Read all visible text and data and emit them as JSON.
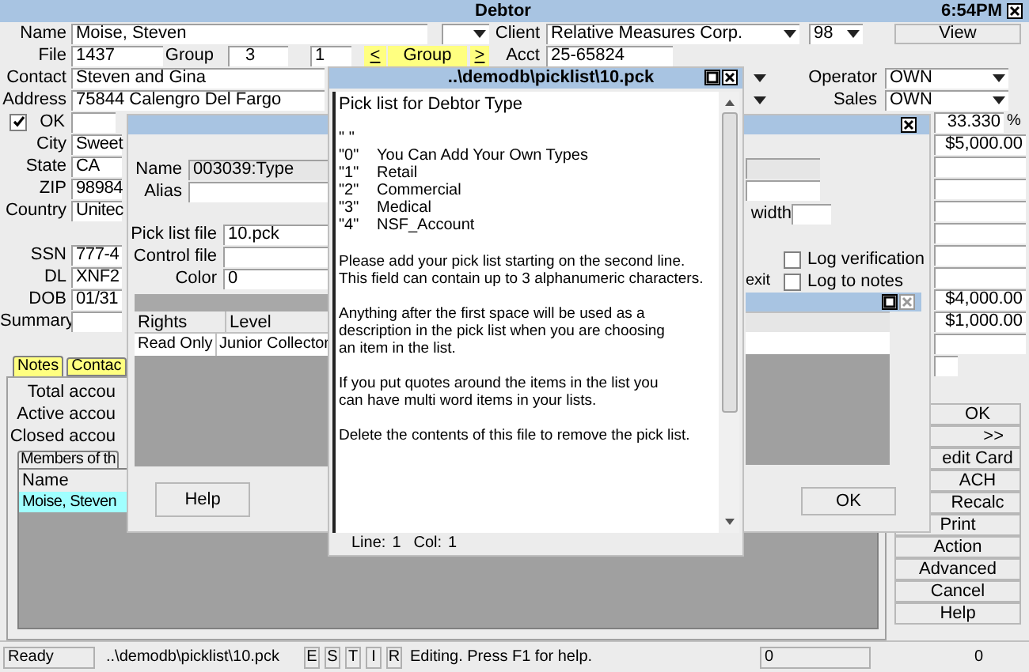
{
  "main": {
    "title": "Debtor",
    "clock": "6:54PM",
    "name": {
      "label": "Name",
      "value": "Moise, Steven"
    },
    "client": {
      "label": "Client",
      "value": "Relative Measures Corp.",
      "number": "98"
    },
    "view_button": "View",
    "file": {
      "label": "File",
      "value": "1437"
    },
    "group": {
      "label": "Group",
      "value": "3",
      "page": "1",
      "prev": "<",
      "button": "Group",
      "next": ">"
    },
    "acct": {
      "label": "Acct",
      "value": "25-65824"
    },
    "contact": {
      "label": "Contact",
      "value": "Steven and Gina"
    },
    "address": {
      "label": "Address",
      "value": "75844 Calengro Del Fargo"
    },
    "operator": {
      "label": "Operator",
      "value": "OWN"
    },
    "sales": {
      "label": "Sales",
      "value": "OWN"
    },
    "ok_checkbox": {
      "label": "OK",
      "checked": true
    },
    "fields": [
      {
        "label": "City",
        "value": "Sweet"
      },
      {
        "label": "State",
        "value": "CA"
      },
      {
        "label": "ZIP",
        "value": "98984"
      },
      {
        "label": "Country",
        "value": "Unitec"
      },
      {
        "label": "SSN",
        "value": "777-4"
      },
      {
        "label": "DL",
        "value": "XNF2"
      },
      {
        "label": "DOB",
        "value": "01/31"
      },
      {
        "label": "Summary"
      }
    ],
    "percent": {
      "value": "33.330",
      "unit": "%"
    },
    "amounts_top": [
      "$5,000.00"
    ],
    "amounts_bottom": [
      "$4,000.00",
      "$1,000.00"
    ],
    "tabs": [
      {
        "label": "Notes",
        "selected": true
      },
      {
        "label": "Contac",
        "selected": false
      }
    ],
    "counts": [
      "Total accou",
      "Active accou",
      "Closed accou"
    ],
    "members": {
      "tab": "Members of th",
      "column": "Name",
      "rows": [
        {
          "name": "Moise, Steven",
          "selected": true
        }
      ]
    },
    "side_buttons": [
      "OK",
      ">>",
      "edit Card",
      "ACH",
      "Recalc",
      "Print",
      "Action",
      "Advanced",
      "Cancel",
      "Help"
    ]
  },
  "dialog": {
    "name": {
      "label": "Name",
      "value": "003039:Type"
    },
    "alias": {
      "label": "Alias"
    },
    "pick_list_file": {
      "label": "Pick list file",
      "value": "10.pck"
    },
    "control_file": {
      "label": "Control file"
    },
    "color": {
      "label": "Color",
      "value": "0"
    },
    "table": {
      "columns": [
        "Rights",
        "Level"
      ],
      "rows": [
        [
          "Read Only",
          "Junior Collector"
        ]
      ]
    },
    "help_button": "Help",
    "width_label": "width",
    "exit_label": "exit",
    "checkboxes": [
      {
        "label": "Log verification",
        "checked": false
      },
      {
        "label": "Log to notes",
        "checked": false
      }
    ],
    "ok_button": "OK"
  },
  "editor": {
    "title": "..\\demodb\\picklist\\10.pck",
    "paragraphs": [
      {
        "kind": "text",
        "lines": [
          "Pick list for Debtor Type"
        ]
      },
      {
        "kind": "items",
        "items": [
          {
            "code": "\" \""
          },
          {
            "code": "\"0\"",
            "text": "You Can Add Your Own Types"
          },
          {
            "code": "\"1\"",
            "text": "Retail"
          },
          {
            "code": "\"2\"",
            "text": "Commercial"
          },
          {
            "code": "\"3\"",
            "text": "Medical"
          },
          {
            "code": "\"4\"",
            "text": "NSF_Account"
          }
        ]
      },
      {
        "kind": "text",
        "lines": [
          "Please add your pick list starting on the second line.",
          "This field can contain up to 3 alphanumeric characters."
        ]
      },
      {
        "kind": "text",
        "lines": [
          "Anything after the first space will be used as a",
          "description in the pick list when you are choosing",
          "an item in the list."
        ]
      },
      {
        "kind": "text",
        "lines": [
          "If you put quotes around the items in the list you",
          "can have multi word items in your lists."
        ]
      },
      {
        "kind": "text",
        "lines": [
          "Delete the contents of this file to remove the pick list."
        ]
      }
    ],
    "status": {
      "line_label": "Line:",
      "line": "1",
      "col_label": "Col:",
      "col": "1"
    }
  },
  "status_bar": {
    "state": "Ready",
    "file": "..\\demodb\\picklist\\10.pck",
    "flags": [
      "E",
      "S",
      "T",
      "I",
      "R"
    ],
    "message": "Editing. Press F1 for help.",
    "counters": [
      "0",
      "0"
    ]
  }
}
